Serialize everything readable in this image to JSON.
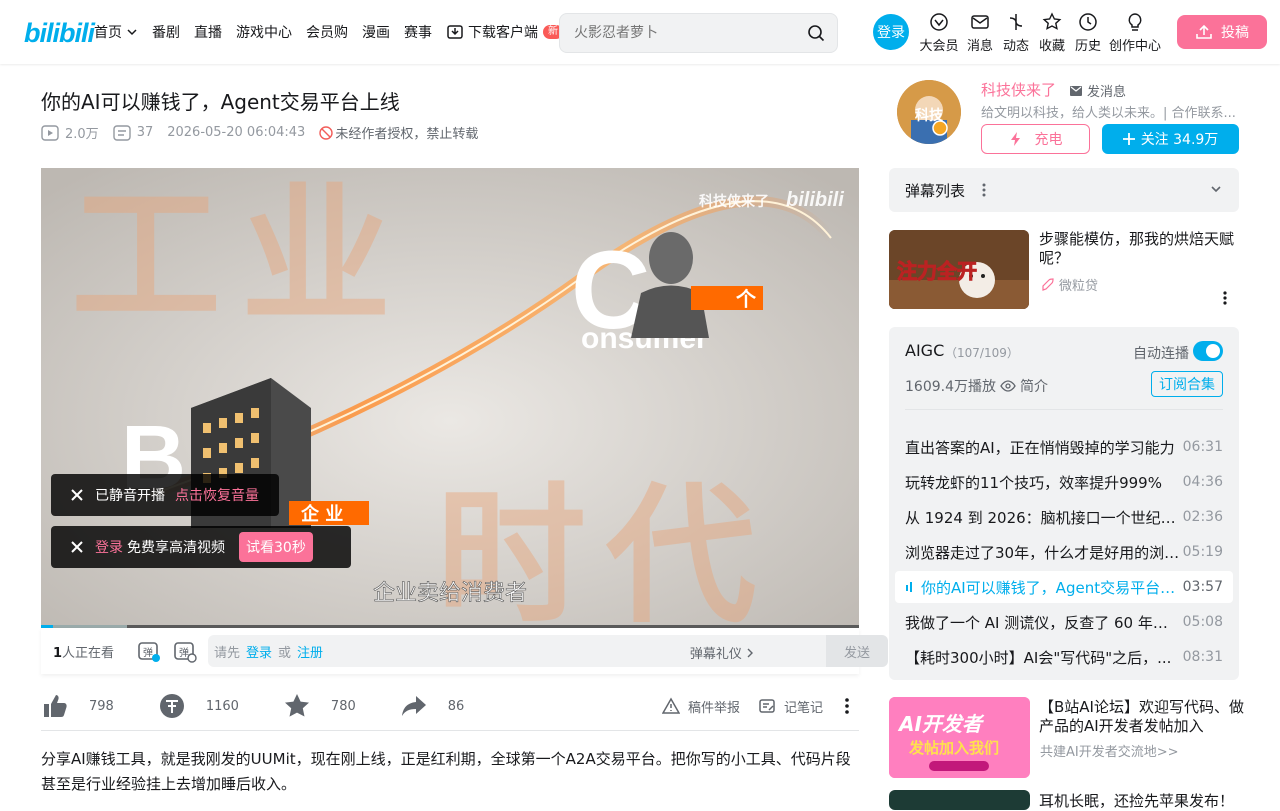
{
  "header": {
    "logo": "bilibili",
    "nav": [
      "首页",
      "番剧",
      "直播",
      "游戏中心",
      "会员购",
      "漫画",
      "赛事",
      "下载客户端"
    ],
    "new_badge": "新",
    "search_placeholder": "火影忍者萝卜",
    "login": "登录",
    "right_nav": [
      "大会员",
      "消息",
      "动态",
      "收藏",
      "历史",
      "创作中心"
    ],
    "upload": "投稿"
  },
  "video": {
    "title": "你的AI可以赚钱了，Agent交易平台上线",
    "views": "2.0万",
    "danmaku_count": "37",
    "date": "2026-05-20 06:04:43",
    "copyright": "未经作者授权，禁止转载",
    "progress": 0.015
  },
  "player": {
    "watermark": "科技侠来了",
    "overlay_big": [
      "工",
      "业",
      "时",
      "代"
    ],
    "overlay_c": "C",
    "overlay_onsumer": "onsumer",
    "overlay_ge": "个",
    "overlay_qiye": "企 业",
    "overlay_b": "B",
    "subtitle": "企业卖给消费者",
    "toast1_text": "已静音开播",
    "toast1_action": "点击恢复音量",
    "toast2_login": "登录",
    "toast2_text": "免费享高清视频",
    "toast2_btn": "试看30秒"
  },
  "danmaku_bar": {
    "watching_num": "1",
    "watching_text": "人正在看",
    "prompt_a": "请先",
    "login": "登录",
    "or": "或",
    "register": "注册",
    "etiquette": "弹幕礼仪",
    "send": "发送"
  },
  "toolbar": {
    "like": "798",
    "coin": "1160",
    "fav": "780",
    "share": "86",
    "report": "稿件举报",
    "note": "记笔记"
  },
  "description": "分享AI赚钱工具，就是我刚发的UUMit，现在刚上线，正是红利期，全球第一个A2A交易平台。把你写的小工具、代码片段甚至是行业经验挂上去增加睡后收入。",
  "uploader": {
    "name": "科技侠来了",
    "message": "发消息",
    "signature": "给文明以科技，给人类以未来。| 合作联系...",
    "charge": "充电",
    "follow": "关注 34.9万",
    "avatar_text": "科技"
  },
  "danmaku_list": {
    "title": "弹幕列表"
  },
  "ad1": {
    "title": "步骤能模仿，那我的烘焙天赋呢？",
    "source": "微粒贷",
    "img_text": "注力全开"
  },
  "collection": {
    "title": "AIGC",
    "count": "（107/109）",
    "auto": "自动连播",
    "plays": "1609.4万播放",
    "intro": "简介",
    "subscribe": "订阅合集",
    "episodes": [
      {
        "title": "直出答案的AI，正在悄悄毁掉的学习能力",
        "dur": "06:31"
      },
      {
        "title": "玩转龙虾的11个技巧，效率提升999%",
        "dur": "04:36"
      },
      {
        "title": "从 1924 到 2026：脑机接口一个世纪的...",
        "dur": "02:36"
      },
      {
        "title": "浏览器走过了30年，什么才是好用的浏览器",
        "dur": "05:19"
      },
      {
        "title": "你的AI可以赚钱了，Agent交易平台上线",
        "dur": "03:57"
      },
      {
        "title": "我做了一个 AI 测谎仪，反查了 60 年的...",
        "dur": "05:08"
      },
      {
        "title": "【耗时300小时】AI会\"写代码\"之后，...",
        "dur": "08:31"
      }
    ],
    "active_index": 4
  },
  "ad2": {
    "title": "【B站AI论坛】欢迎写代码、做产品的AI开发者发帖加入",
    "source": "共建AI开发者交流地>>",
    "img_line1": "AI开发者",
    "img_line2": "发帖加入我们"
  },
  "ad3": {
    "title": "耳机长眠，还捡先苹果发布！"
  },
  "colors": {
    "brand": "#00aeec",
    "pink": "#fb7299",
    "bg_panel": "#f1f2f3"
  }
}
